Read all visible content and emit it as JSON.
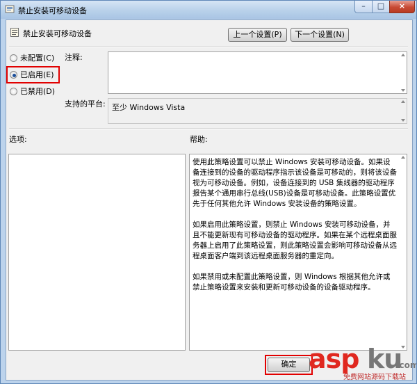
{
  "window": {
    "title": "禁止安装可移动设备",
    "controls": {
      "minimize": "–",
      "maximize": "□",
      "close": "×"
    }
  },
  "header": {
    "setting_title": "禁止安装可移动设备",
    "prev_button": "上一个设置(P)",
    "next_button": "下一个设置(N)"
  },
  "options": {
    "not_configured": "未配置(C)",
    "enabled": "已启用(E)",
    "disabled": "已禁用(D)",
    "selected": "enabled"
  },
  "comment": {
    "label": "注释:",
    "value": ""
  },
  "platform": {
    "label": "支持的平台:",
    "value": "至少 Windows Vista"
  },
  "sections": {
    "options_label": "选项:",
    "help_label": "帮助:"
  },
  "help": {
    "paragraphs": [
      "使用此策略设置可以禁止 Windows 安装可移动设备。如果设备连接到的设备的驱动程序指示该设备是可移动的，则将该设备视为可移动设备。例如，设备连接到的 USB 集线器的驱动程序报告某个通用串行总线(USB)设备是可移动设备。此策略设置优先于任何其他允许 Windows 安装设备的策略设置。",
      "如果启用此策略设置，则禁止 Windows 安装可移动设备，并且不能更新现有可移动设备的驱动程序。如果在某个远程桌面服务器上启用了此策略设置，则此策略设置会影响可移动设备从远程桌面客户端到该远程桌面服务器的重定向。",
      "如果禁用或未配置此策略设置，则 Windows 根据其他允许或禁止策略设置来安装和更新可移动设备的设备驱动程序。"
    ]
  },
  "footer": {
    "ok_button": "确定"
  },
  "watermark": {
    "brand_red": "asp",
    "brand_gray": "ku",
    "suffix": ".com",
    "subtitle": "免费网站源码下载站"
  },
  "colors": {
    "highlight": "#e10000",
    "titlebar": "#b9d1ea",
    "dialog_bg": "#f0f0f0"
  }
}
